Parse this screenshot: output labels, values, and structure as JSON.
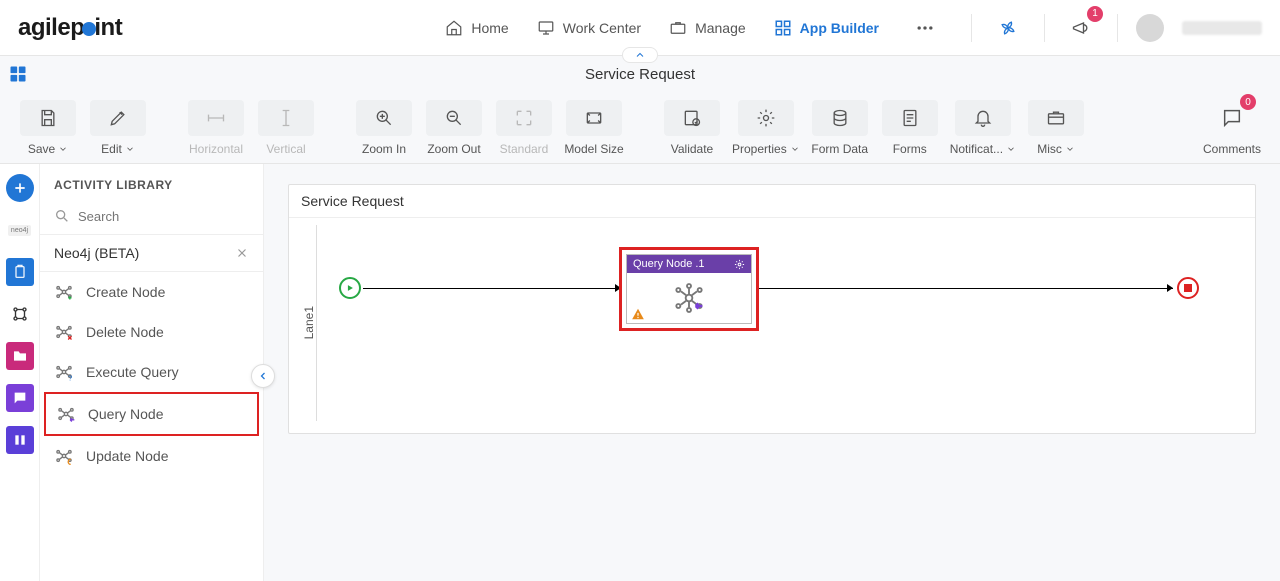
{
  "brand": "agilepoint",
  "nav": {
    "home": "Home",
    "workCenter": "Work Center",
    "manage": "Manage",
    "appBuilder": "App Builder",
    "notificationCount": "1"
  },
  "page": {
    "title": "Service Request"
  },
  "toolbar": {
    "save": "Save",
    "edit": "Edit",
    "horizontal": "Horizontal",
    "vertical": "Vertical",
    "zoomIn": "Zoom In",
    "zoomOut": "Zoom Out",
    "standard": "Standard",
    "modelSize": "Model Size",
    "validate": "Validate",
    "properties": "Properties",
    "formData": "Form Data",
    "forms": "Forms",
    "notifications": "Notificat...",
    "misc": "Misc",
    "comments": "Comments",
    "commentsBadge": "0"
  },
  "library": {
    "heading": "ACTIVITY LIBRARY",
    "searchPlaceholder": "Search",
    "group": "Neo4j (BETA)",
    "items": {
      "createNode": "Create Node",
      "deleteNode": "Delete Node",
      "executeQuery": "Execute Query",
      "queryNode": "Query Node",
      "updateNode": "Update Node"
    }
  },
  "rail": {
    "neo4jLabel": "neo4j"
  },
  "canvas": {
    "processTitle": "Service Request",
    "lane": "Lane1",
    "activityNode": {
      "title": "Query Node .1"
    }
  }
}
